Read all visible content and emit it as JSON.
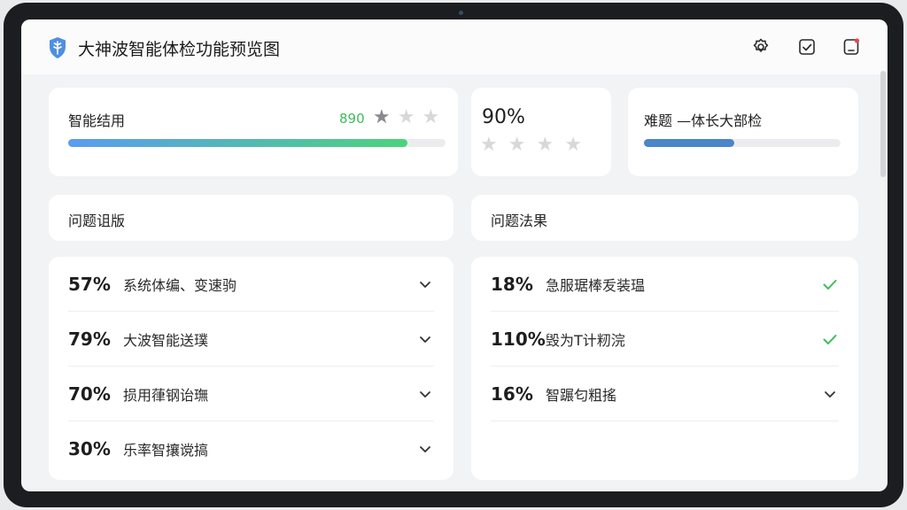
{
  "app": {
    "title": "大神波智能体检功能预览图"
  },
  "header_icons": [
    "settings-icon",
    "checklist-icon",
    "notification-icon"
  ],
  "summary": {
    "card1": {
      "label": "智能结用",
      "score": "890",
      "stars_filled": 1,
      "stars_total": 3,
      "progress": 0.9
    },
    "card2": {
      "percent": "90%",
      "stars_total": 4
    },
    "card3": {
      "label": "难题 —体长大部检",
      "progress": 0.46
    }
  },
  "sections": {
    "left_title": "问题诅版",
    "right_title": "问题法果"
  },
  "left_list": [
    {
      "pct": "57%",
      "label": "系统体编、变速驹",
      "icon": "chevron-down-icon"
    },
    {
      "pct": "79%",
      "label": "大波智能送璞",
      "icon": "chevron-down-icon"
    },
    {
      "pct": "70%",
      "label": "损用葎钢诒璑",
      "icon": "chevron-down-icon"
    },
    {
      "pct": "30%",
      "label": "乐率智攘谠搞",
      "icon": "chevron-down-icon"
    }
  ],
  "right_list": [
    {
      "pct": "18%",
      "label": "急服琚棒叐装瑥",
      "icon": "check-icon"
    },
    {
      "pct": "110%",
      "label": "毁为T计籾浣",
      "icon": "check-icon"
    },
    {
      "pct": "16%",
      "label": "智蹍匂粗搖",
      "icon": "chevron-down-icon"
    }
  ],
  "colors": {
    "progress_gradient_start": "#5a9cf0",
    "progress_gradient_end": "#4cd37c",
    "progress_blue": "#4a86c8",
    "accent_green": "#3ebd5b",
    "logo_blue": "#4f8fe0"
  }
}
